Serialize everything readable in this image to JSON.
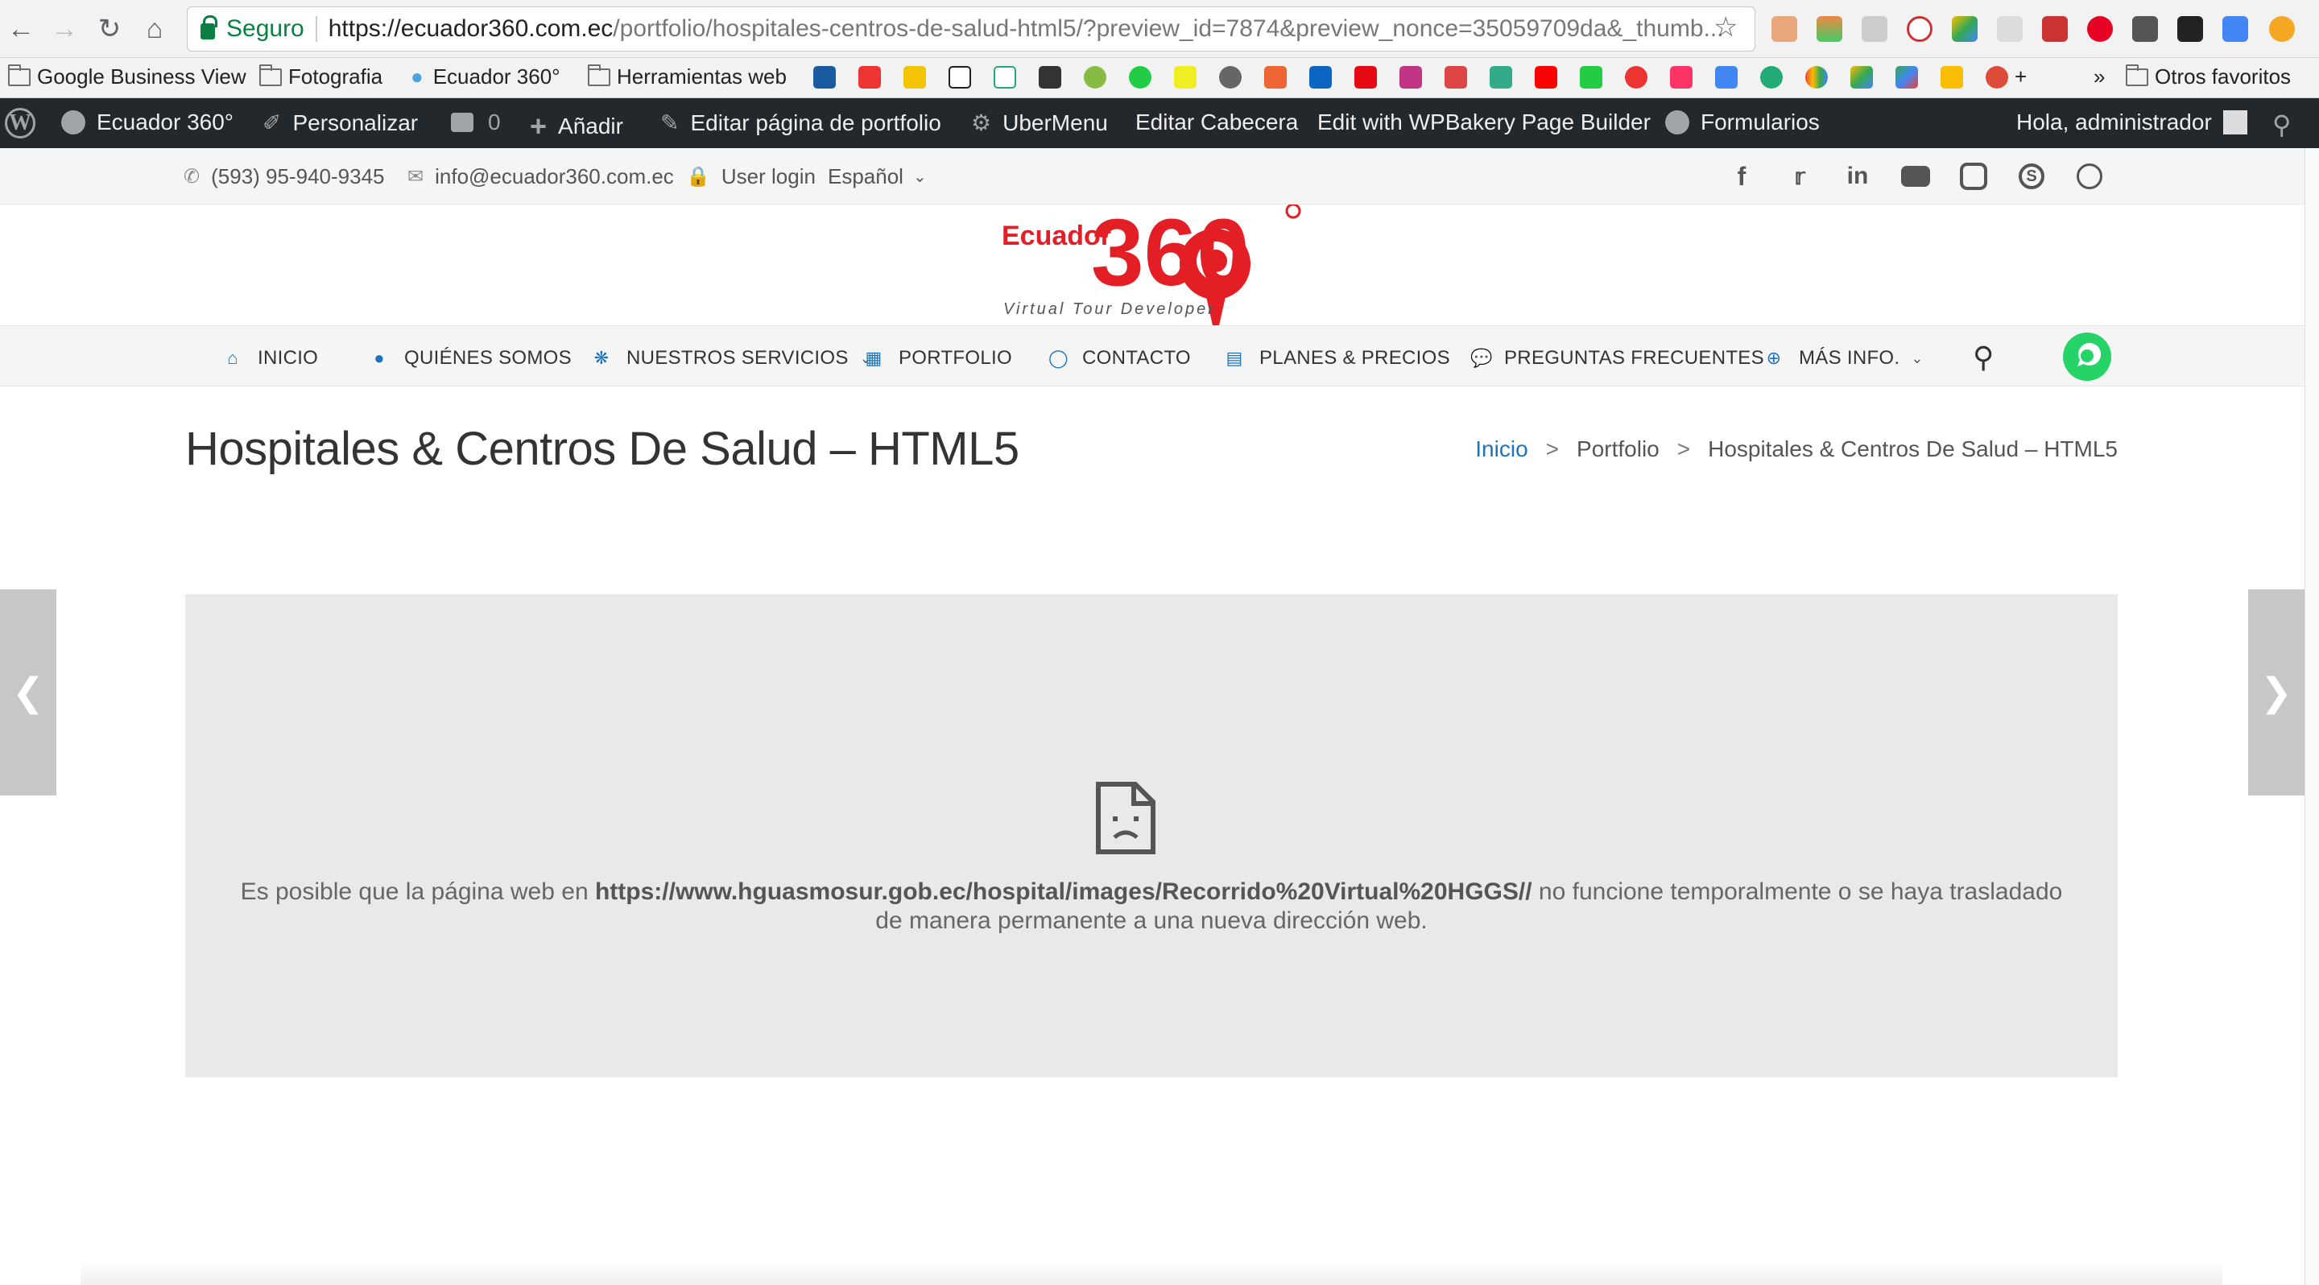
{
  "browser": {
    "secure_label": "Seguro",
    "url_main": "https://ecuador360.com.ec",
    "url_rest": "/portfolio/hospitales-centros-de-salud-html5/?preview_id=7874&preview_nonce=35059709da&_thumb..."
  },
  "bookmarks": {
    "items": [
      "Google Business View",
      "Fotografia",
      "Ecuador 360°",
      "Herramientas web"
    ],
    "more": "»",
    "other": "Otros favoritos"
  },
  "wp_admin": {
    "site": "Ecuador 360°",
    "customize": "Personalizar",
    "comments": "0",
    "add": "Añadir",
    "edit_page": "Editar página de portfolio",
    "ubermenu": "UberMenu",
    "edit_header": "Editar Cabecera",
    "wpbakery": "Edit with WPBakery Page Builder",
    "forms": "Formularios",
    "greeting": "Hola, administrador"
  },
  "topbar": {
    "phone": "(593) 95-940-9345",
    "email": "info@ecuador360.com.ec",
    "login": "User login",
    "language": "Español"
  },
  "logo": {
    "brand": "Ecuador",
    "number": "360",
    "tagline": "Virtual Tour Developer"
  },
  "nav": {
    "items": [
      "INICIO",
      "QUIÉNES SOMOS",
      "NUESTROS SERVICIOS",
      "PORTFOLIO",
      "CONTACTO",
      "PLANES & PRECIOS",
      "PREGUNTAS FRECUENTES",
      "MÁS INFO."
    ]
  },
  "page": {
    "title": "Hospitales & Centros De Salud – HTML5",
    "breadcrumb": [
      "Inicio",
      "Portfolio",
      "Hospitales & Centros De Salud – HTML5"
    ]
  },
  "error": {
    "prefix": "Es posible que la página web en ",
    "url": "https://www.hguasmosur.gob.ec/hospital/images/Recorrido%20Virtual%20HGGS//",
    "suffix": " no funcione temporalmente o se haya trasladado de manera permanente a una nueva dirección web."
  }
}
